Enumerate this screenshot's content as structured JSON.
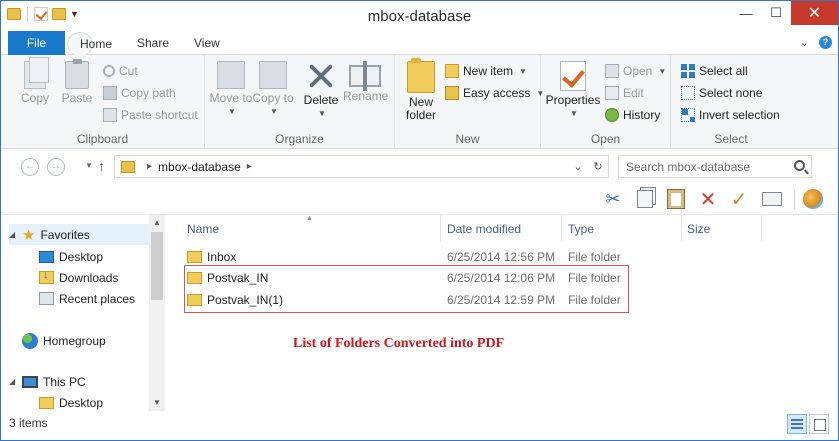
{
  "window": {
    "title": "mbox-database",
    "controls": {
      "minimize": "—",
      "maximize": "☐",
      "close": "✕"
    }
  },
  "tabs": [
    {
      "label": "File"
    },
    {
      "label": "Home"
    },
    {
      "label": "Share"
    },
    {
      "label": "View"
    }
  ],
  "ribbon": {
    "clipboard": {
      "label": "Clipboard",
      "copy": "Copy",
      "paste": "Paste",
      "cut": "Cut",
      "copy_path": "Copy path",
      "paste_shortcut": "Paste shortcut"
    },
    "organize": {
      "label": "Organize",
      "move_to": "Move to",
      "copy_to": "Copy to",
      "delete": "Delete",
      "rename": "Rename"
    },
    "new": {
      "label": "New",
      "new_folder": "New folder",
      "new_item": "New item",
      "easy_access": "Easy access"
    },
    "open": {
      "label": "Open",
      "properties": "Properties",
      "open": "Open",
      "edit": "Edit",
      "history": "History"
    },
    "select": {
      "label": "Select",
      "select_all": "Select all",
      "select_none": "Select none",
      "invert_selection": "Invert selection"
    }
  },
  "address": {
    "path_segment": "mbox-database",
    "search_placeholder": "Search mbox-database"
  },
  "nav": {
    "favorites": "Favorites",
    "desktop": "Desktop",
    "downloads": "Downloads",
    "recent_places": "Recent places",
    "homegroup": "Homegroup",
    "this_pc": "This PC",
    "pc_desktop": "Desktop"
  },
  "columns": {
    "name": "Name",
    "date_modified": "Date modified",
    "type": "Type",
    "size": "Size"
  },
  "files": [
    {
      "name": "Inbox",
      "date": "6/25/2014 12:56 PM",
      "type": "File folder"
    },
    {
      "name": "Postvak_IN",
      "date": "6/25/2014 12:06 PM",
      "type": "File folder"
    },
    {
      "name": "Postvak_IN(1)",
      "date": "6/25/2014 12:59 PM",
      "type": "File folder"
    }
  ],
  "annotation": "List of Folders Converted into PDF",
  "status": {
    "item_count": "3 items"
  },
  "colors": {
    "accent": "#1979ca",
    "close": "#c7392b",
    "highlight": "#d9534f",
    "annotation": "#d2141c"
  }
}
